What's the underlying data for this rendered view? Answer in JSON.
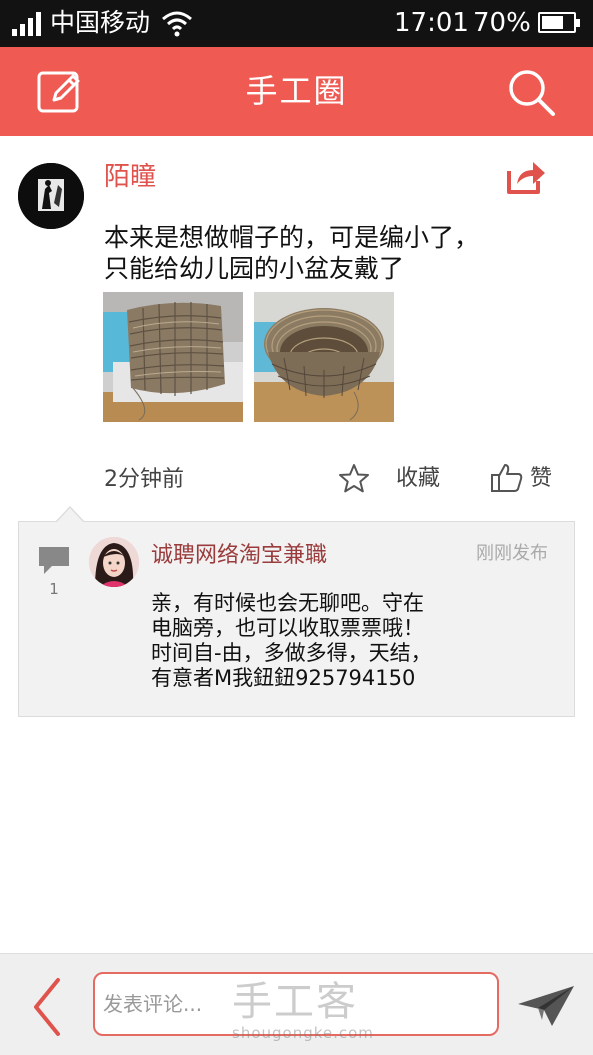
{
  "status_bar": {
    "carrier": "中国移动",
    "time": "17:01",
    "battery_percent": "70%",
    "battery_level": 0.7
  },
  "app_bar": {
    "title": "手工圈",
    "left_icon": "edit-icon",
    "right_icon": "search-icon"
  },
  "post": {
    "username": "陌瞳",
    "text_line1": "本来是想做帽子的，可是编小了，",
    "text_line2": "只能给幼儿园的小盆友戴了",
    "time_ago": "2分钟前",
    "favorite_label": "收藏",
    "like_label": "赞",
    "share_icon": "share-icon",
    "images": [
      "woven-basket-side-photo",
      "woven-basket-top-photo"
    ]
  },
  "comments": {
    "count": "1",
    "items": [
      {
        "name": "诚聘网络淘宝兼職",
        "date": "刚刚发布",
        "line1": "亲，有时候也会无聊吧。守在",
        "line2": "电脑旁，也可以收取票票哦！",
        "line3": "时间自-由，多做多得，天结，",
        "line4": "有意者M我鈕鈕925794150"
      }
    ]
  },
  "bottom_bar": {
    "placeholder": "发表评论...",
    "back_icon": "chevron-left-icon",
    "send_icon": "send-icon"
  },
  "watermark": {
    "main": "手工客",
    "sub": "shougongke.com"
  },
  "colors": {
    "brand": "#ef5a52",
    "username": "#e0534c",
    "comment_name": "#9a3c3c",
    "status_bar": "#121212"
  }
}
